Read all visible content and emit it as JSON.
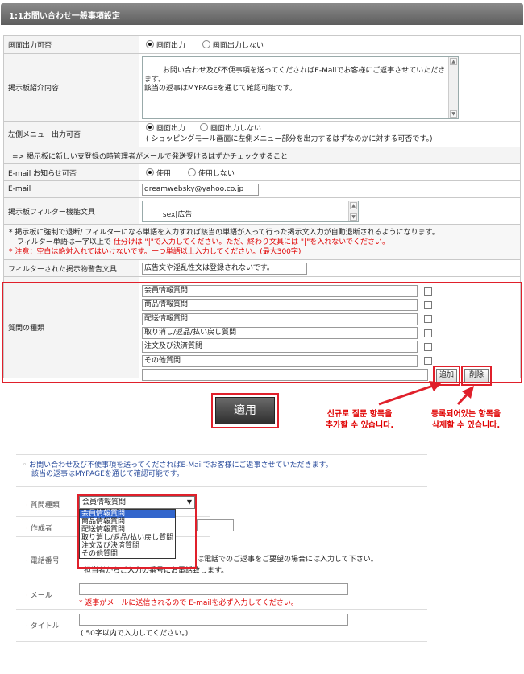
{
  "header": {
    "title": "1:1お問い合わせ一般事項設定"
  },
  "rows": {
    "board_output": {
      "label": "画面出力可否",
      "opt_on": "画面出力",
      "opt_off": "画面出力しない"
    },
    "board_intro": {
      "label": "掲示板紹介内容",
      "text": "お問い合わせ及び不便事項を送ってくださればE-Mailでお客様にご返事させていただきます。\n該当の返事はMYPAGEを通じて確認可能です。"
    },
    "left_menu": {
      "label": "左側メニュー出力可否",
      "opt_on": "画面出力",
      "opt_off": "画面出力しない",
      "note": "( ショッピングモール画面に左側メニュー部分を出力するはずなのかに対する可否です。)"
    },
    "notice_line": "=> 掲示板に新しい支登録の時管理者がメールで発送受けるはずかチェックすること",
    "email_notify": {
      "label": "E-mail お知らせ可否",
      "opt_on": "使用",
      "opt_off": "使用しない"
    },
    "email": {
      "label": "E-mail",
      "value": "dreamwebsky@yahoo.co.jp"
    },
    "filter_words": {
      "label": "掲示板フィルター機能文具",
      "value": "sex|広告"
    },
    "filter_help": {
      "line1": "* 掲示板に強制で退断/ フィルターになる単語を入力すれば該当の単語が入って行った掲示文入力が自動退断されるようになります。",
      "line2a": "フィルター単語は一字以上で ",
      "line2b": "仕分けは \"|\"で入力してください。ただ、終わり文具には \"|\"を入れないでください。",
      "line3": "* 注意：空白は絶対入れてはいけないです。一つ単語以上入力してください。(最大300字)"
    },
    "filter_warning": {
      "label": "フィルターされた掲示物警告文具",
      "value": "広告文や淫乱性文は登録されないです。"
    },
    "question_types": {
      "label": "質問の種類",
      "items": [
        "会員情報質問",
        "商品情報質問",
        "配送情報質問",
        "取り消し/返品/払い戻し質問",
        "注文及び決済質問",
        "その他質問",
        ""
      ],
      "add": "追加",
      "delete": "削除"
    }
  },
  "apply_button": "適用",
  "annotations": {
    "add_note": "신규로 질문 항목을\n추가할 수 있습니다.",
    "delete_note": "등록되어있는 항목을\n삭제할 수 있습니다."
  },
  "preview": {
    "intro1": "お問い合わせ及び不便事項を送ってくださればE-Mailでお客様にご返事させていただきます。",
    "intro2": "該当の返事はMYPAGEを通じて確認可能です。",
    "question_type_label": "質問種類",
    "selected": "会員情報質問",
    "options": [
      "会員情報質問",
      "商品情報質問",
      "配送情報質問",
      "取り消し/返品/払い戻し質問",
      "注文及び決済質問",
      "その他質問"
    ],
    "author_label": "作成者",
    "phone_label": "電話番号",
    "phone_note1": "は電話でのご返事をご要望の場合には入力して下さい。",
    "phone_note2": "担当者からご入力の番号にお電話致します。",
    "mail_label": "メール",
    "mail_note": "* 返事がメールに送信されるので E-mailを必ず入力してください。",
    "title_label": "タイトル",
    "title_note": "( 50字以内で入力してください。)"
  },
  "colors": {
    "accent_red": "#e0202b",
    "header_bg": "#6f6f6f"
  }
}
